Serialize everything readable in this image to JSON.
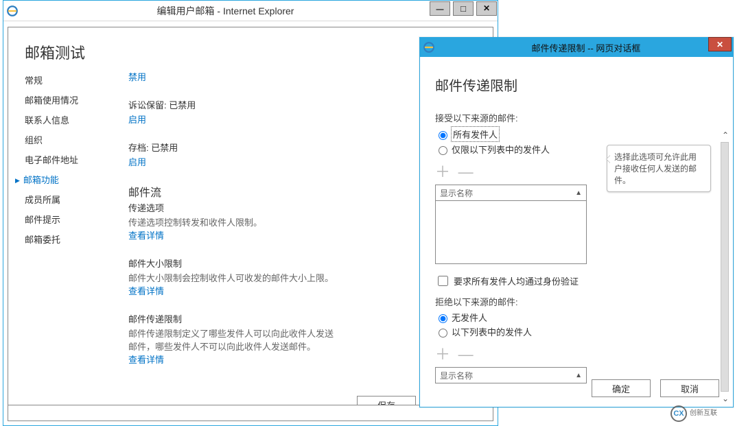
{
  "mainWindow": {
    "title": "编辑用户邮箱 - Internet Explorer",
    "pageHeading": "邮箱测试",
    "nav": {
      "items": [
        {
          "label": "常规"
        },
        {
          "label": "邮箱使用情况"
        },
        {
          "label": "联系人信息"
        },
        {
          "label": "组织"
        },
        {
          "label": "电子邮件地址"
        },
        {
          "label": "邮箱功能"
        },
        {
          "label": "成员所属"
        },
        {
          "label": "邮件提示"
        },
        {
          "label": "邮箱委托"
        }
      ],
      "activeIndex": 5
    },
    "content": {
      "disableLink": "禁用",
      "litigation": {
        "label": "诉讼保留: 已禁用",
        "action": "启用"
      },
      "archive": {
        "label": "存档: 已禁用",
        "action": "启用"
      },
      "mailflow": {
        "heading": "邮件流",
        "delivery": {
          "title": "传递选项",
          "desc": "传递选项控制转发和收件人限制。",
          "link": "查看详情"
        },
        "size": {
          "title": "邮件大小限制",
          "desc": "邮件大小限制会控制收件人可收发的邮件大小上限。",
          "link": "查看详情"
        },
        "restriction": {
          "title": "邮件传递限制",
          "desc": "邮件传递限制定义了哪些发件人可以向此收件人发送邮件，哪些发件人不可以向此收件人发送邮件。",
          "link": "查看详情"
        }
      }
    },
    "footer": {
      "save": "保存",
      "cancel": ""
    }
  },
  "dialog": {
    "title": "邮件传递限制 -- 网页对话框",
    "heading": "邮件传递限制",
    "accept": {
      "label": "接受以下来源的邮件:",
      "optAll": "所有发件人",
      "optList": "仅限以下列表中的发件人",
      "selected": "all"
    },
    "comboPlaceholder": "显示名称",
    "requireAuth": "要求所有发件人均通过身份验证",
    "reject": {
      "label": "拒绝以下来源的邮件:",
      "optNone": "无发件人",
      "optList": "以下列表中的发件人",
      "selected": "none"
    },
    "tooltip": "选择此选项可允许此用户接收任何人发送的邮件。",
    "ok": "确定",
    "cancel": "取消"
  },
  "watermark": {
    "brand": "创新互联",
    "code": "CX"
  }
}
